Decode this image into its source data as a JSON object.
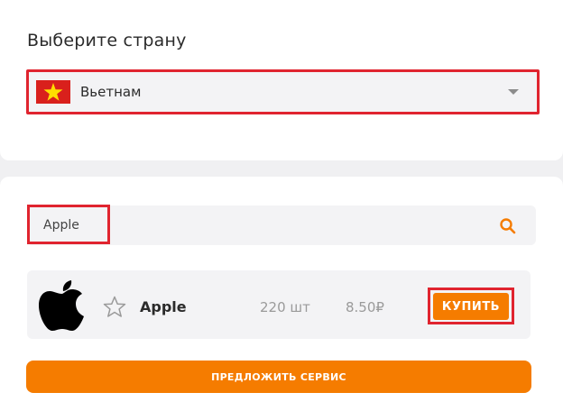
{
  "country": {
    "title": "Выберите страну",
    "selected": "Вьетнам",
    "flag_icon": "vietnam-flag-icon"
  },
  "search": {
    "value": "Apple",
    "icon": "search-icon"
  },
  "services": [
    {
      "name": "Apple",
      "count": "220 шт",
      "price": "8.50₽",
      "buy_label": "КУПИТЬ",
      "icon": "apple-logo-icon",
      "favorite_icon": "star-outline-icon"
    }
  ],
  "offer_label": "ПРЕДЛОЖИТЬ СЕРВИС",
  "colors": {
    "accent": "#f57c00",
    "highlight": "#e0242f",
    "panel": "#f3f3f5"
  }
}
